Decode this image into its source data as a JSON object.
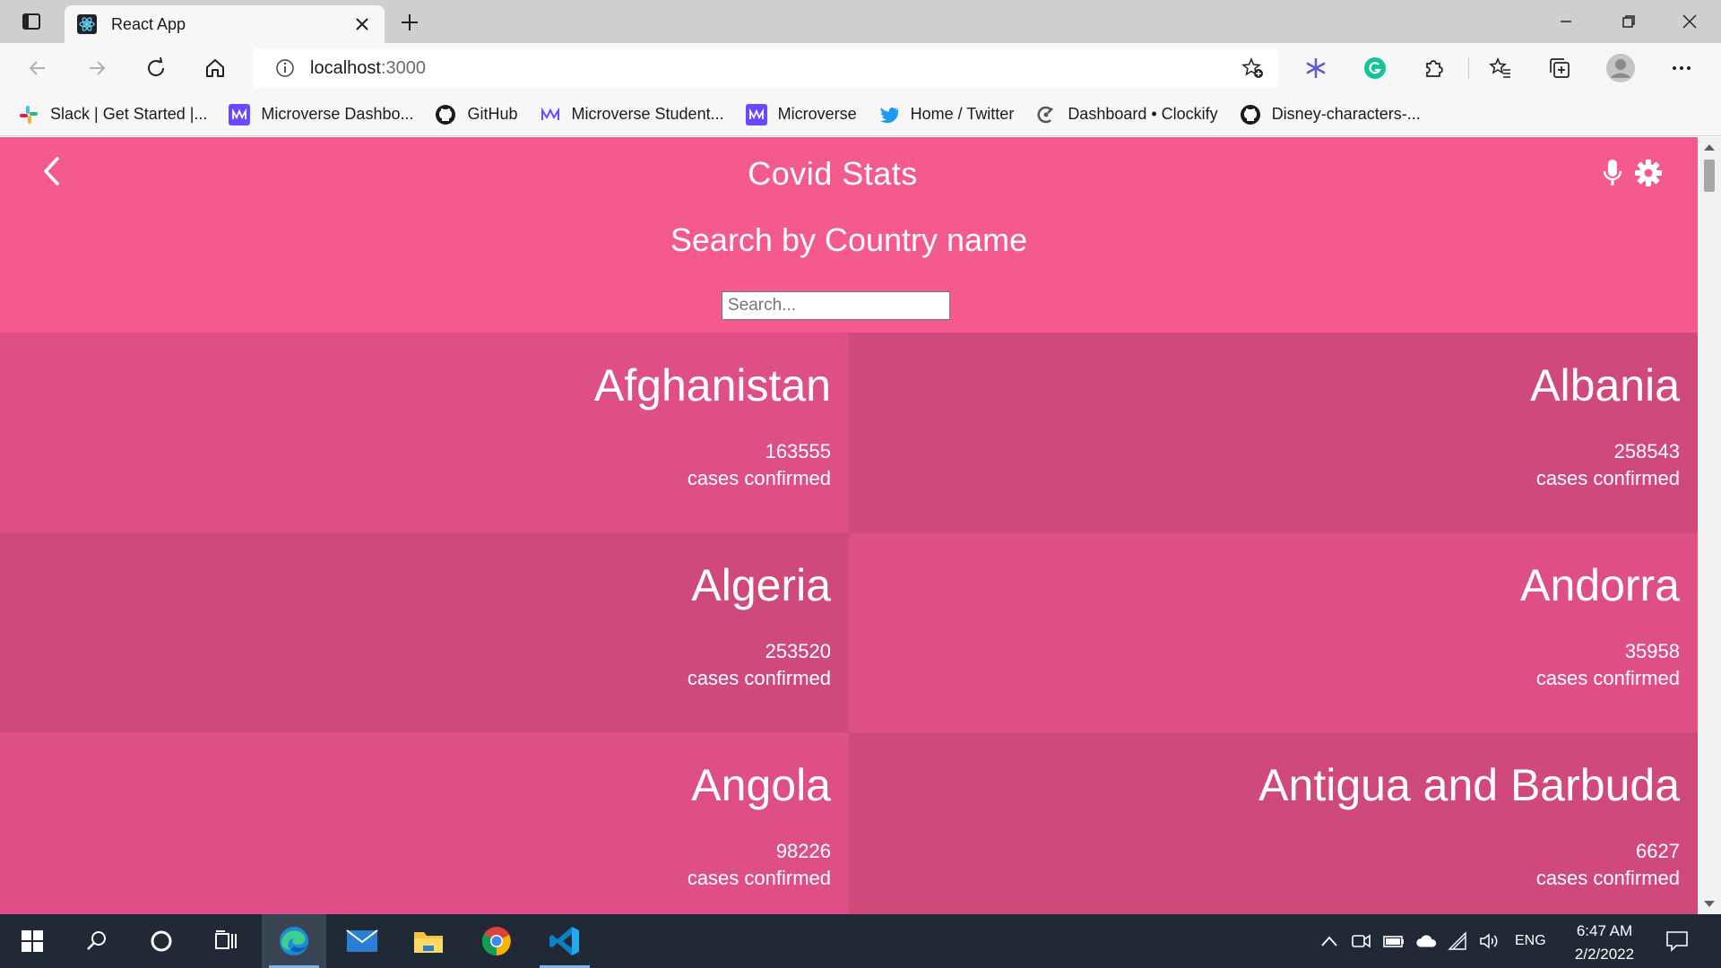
{
  "browser": {
    "tab_title": "React App",
    "url_host": "localhost",
    "url_port": ":3000",
    "bookmarks": [
      {
        "label": "Slack | Get Started |...",
        "icon": "slack-icon"
      },
      {
        "label": "Microverse Dashbo...",
        "icon": "microverse-icon"
      },
      {
        "label": "GitHub",
        "icon": "github-icon"
      },
      {
        "label": "Microverse Student...",
        "icon": "microverse-icon"
      },
      {
        "label": "Microverse",
        "icon": "microverse-icon"
      },
      {
        "label": "Home / Twitter",
        "icon": "twitter-icon"
      },
      {
        "label": "Dashboard • Clockify",
        "icon": "clockify-icon"
      },
      {
        "label": "Disney-characters-...",
        "icon": "github-icon"
      }
    ]
  },
  "app": {
    "title": "Covid Stats",
    "search_heading": "Search by Country name",
    "search_placeholder": "Search...",
    "background_color": "#f45990"
  },
  "countries": [
    {
      "name": "Afghanistan",
      "cases": "163555",
      "label": "cases confirmed",
      "color": "#de4f86"
    },
    {
      "name": "Albania",
      "cases": "258543",
      "label": "cases confirmed",
      "color": "#cf497b"
    },
    {
      "name": "Algeria",
      "cases": "253520",
      "label": "cases confirmed",
      "color": "#cf497b"
    },
    {
      "name": "Andorra",
      "cases": "35958",
      "label": "cases confirmed",
      "color": "#de4f86"
    },
    {
      "name": "Angola",
      "cases": "98226",
      "label": "cases confirmed",
      "color": "#de4f86"
    },
    {
      "name": "Antigua and Barbuda",
      "cases": "6627",
      "label": "cases confirmed",
      "color": "#cf497b"
    }
  ],
  "taskbar": {
    "language": "ENG",
    "time": "6:47 AM",
    "date": "2/2/2022"
  }
}
